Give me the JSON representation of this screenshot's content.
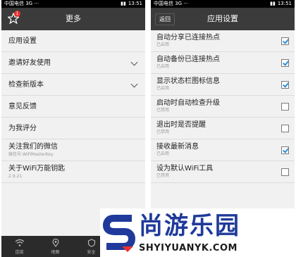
{
  "left_screen": {
    "status_bar": {
      "carrier": "中国电信 3G ···",
      "time": "13:51"
    },
    "header": {
      "title": "更多",
      "badge": "1"
    },
    "menu": [
      {
        "label": "应用设置",
        "sub": "",
        "chevron": false
      },
      {
        "label": "邀请好友使用",
        "sub": "",
        "chevron": true
      },
      {
        "label": "检查新版本",
        "sub": "",
        "chevron": true
      },
      {
        "label": "意见反馈",
        "sub": "",
        "chevron": false
      },
      {
        "label": "为我评分",
        "sub": "",
        "chevron": false
      },
      {
        "label": "关注我们的微信",
        "sub": "微信号:WiFiMasterKey",
        "chevron": false
      },
      {
        "label": "关于WiFi万能钥匙",
        "sub": "2.9.21",
        "chevron": false
      }
    ],
    "tab_bar": [
      {
        "label": "连接",
        "icon": "wifi-icon"
      },
      {
        "label": "地图",
        "icon": "map-pin-icon"
      },
      {
        "label": "安全",
        "icon": "shield-icon"
      },
      {
        "label": "更",
        "icon": "more-icon"
      }
    ]
  },
  "right_screen": {
    "status_bar": {
      "carrier": "中国电信 3G ···",
      "time": "13:51"
    },
    "header": {
      "title": "应用设置",
      "back_label": "返回"
    },
    "settings": [
      {
        "label": "自动分享已连接热点",
        "status": "已启用",
        "checked": true
      },
      {
        "label": "自动备份已连接热点",
        "status": "已启用",
        "checked": true
      },
      {
        "label": "显示状态栏图标信息",
        "status": "已启用",
        "checked": true
      },
      {
        "label": "启动时自动检查升级",
        "status": "已禁用",
        "checked": false
      },
      {
        "label": "退出时是否提醒",
        "status": "已禁用",
        "checked": false
      },
      {
        "label": "接收最新消息",
        "status": "已启用",
        "checked": true
      },
      {
        "label": "设为默认WiFi工具",
        "status": "已禁用",
        "checked": false
      }
    ]
  },
  "watermark": {
    "brand": "尚游乐园",
    "url": "SHYIYUANYK.COM"
  },
  "colors": {
    "header_bg": "#3b3b3b",
    "check_blue": "#2c8fd8",
    "badge_red": "#e8312f",
    "brand_blue": "#1f3a9a"
  }
}
